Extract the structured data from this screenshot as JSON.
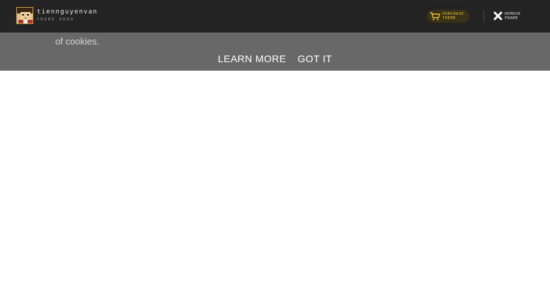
{
  "topbar": {
    "brand_name": "tiennguyenvan",
    "brand_subtitle": "THEME DEMO",
    "purchase_line1": "PURCHASE",
    "purchase_line2": "THEME",
    "remove_line1": "REMOVE",
    "remove_line2": "FRAME",
    "accent_color": "#e8c22e",
    "bar_color": "#232323",
    "avatar_icon": "avatar-icon",
    "cart_icon": "cart-icon",
    "close_icon": "close-icon"
  },
  "cookie_banner": {
    "message": "of cookies.",
    "learn_more_label": "LEARN MORE",
    "got_it_label": "GOT IT",
    "background_color": "#686868"
  }
}
